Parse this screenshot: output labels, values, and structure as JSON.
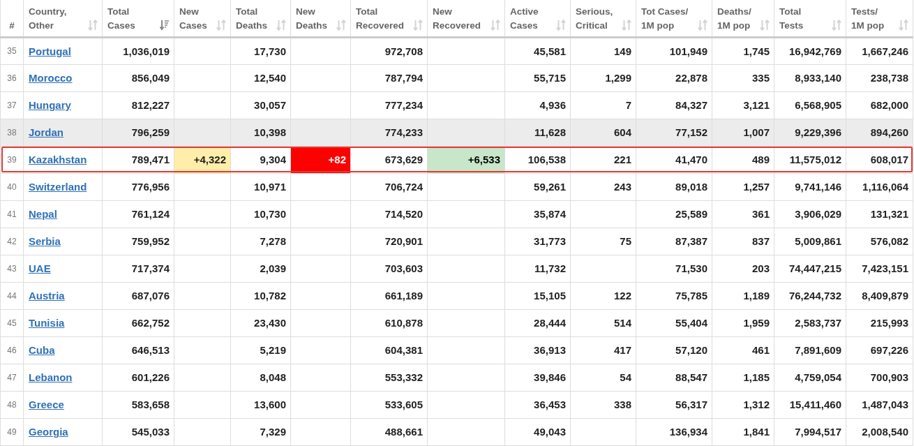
{
  "table": {
    "columns": [
      {
        "label": "#",
        "kind": "index"
      },
      {
        "label": "Country,\nOther",
        "kind": "country",
        "sorted": false
      },
      {
        "label": "Total\nCases",
        "kind": "number",
        "sorted": true
      },
      {
        "label": "New\nCases",
        "kind": "new-cases",
        "sorted": false
      },
      {
        "label": "Total\nDeaths",
        "kind": "number",
        "sorted": false
      },
      {
        "label": "New\nDeaths",
        "kind": "new-deaths",
        "sorted": false
      },
      {
        "label": "Total\nRecovered",
        "kind": "number",
        "sorted": false
      },
      {
        "label": "New\nRecovered",
        "kind": "new-recovered",
        "sorted": false
      },
      {
        "label": "Active\nCases",
        "kind": "number",
        "sorted": false
      },
      {
        "label": "Serious,\nCritical",
        "kind": "number",
        "sorted": false
      },
      {
        "label": "Tot Cases/\n1M pop",
        "kind": "number",
        "sorted": false
      },
      {
        "label": "Deaths/\n1M pop",
        "kind": "number",
        "sorted": false
      },
      {
        "label": "Total\nTests",
        "kind": "number",
        "sorted": false
      },
      {
        "label": "Tests/\n1M pop",
        "kind": "number",
        "sorted": false
      }
    ],
    "rows": [
      {
        "hovered": false,
        "highlighted": false,
        "cells": [
          "35",
          "Portugal",
          "1,036,019",
          null,
          "17,730",
          null,
          "972,708",
          null,
          "45,581",
          "149",
          "101,949",
          "1,745",
          "16,942,769",
          "1,667,246"
        ]
      },
      {
        "hovered": false,
        "highlighted": false,
        "cells": [
          "36",
          "Morocco",
          "856,049",
          null,
          "12,540",
          null,
          "787,794",
          null,
          "55,715",
          "1,299",
          "22,878",
          "335",
          "8,933,140",
          "238,738"
        ]
      },
      {
        "hovered": false,
        "highlighted": false,
        "cells": [
          "37",
          "Hungary",
          "812,227",
          null,
          "30,057",
          null,
          "777,234",
          null,
          "4,936",
          "7",
          "84,327",
          "3,121",
          "6,568,905",
          "682,000"
        ]
      },
      {
        "hovered": true,
        "highlighted": false,
        "cells": [
          "38",
          "Jordan",
          "796,259",
          null,
          "10,398",
          null,
          "774,233",
          null,
          "11,628",
          "604",
          "77,152",
          "1,007",
          "9,229,396",
          "894,260"
        ]
      },
      {
        "hovered": false,
        "highlighted": true,
        "cells": [
          "39",
          "Kazakhstan",
          "789,471",
          "+4,322",
          "9,304",
          "+82",
          "673,629",
          "+6,533",
          "106,538",
          "221",
          "41,470",
          "489",
          "11,575,012",
          "608,017"
        ]
      },
      {
        "hovered": false,
        "highlighted": false,
        "cells": [
          "40",
          "Switzerland",
          "776,956",
          null,
          "10,971",
          null,
          "706,724",
          null,
          "59,261",
          "243",
          "89,018",
          "1,257",
          "9,741,146",
          "1,116,064"
        ]
      },
      {
        "hovered": false,
        "highlighted": false,
        "cells": [
          "41",
          "Nepal",
          "761,124",
          null,
          "10,730",
          null,
          "714,520",
          null,
          "35,874",
          null,
          "25,589",
          "361",
          "3,906,029",
          "131,321"
        ]
      },
      {
        "hovered": false,
        "highlighted": false,
        "cells": [
          "42",
          "Serbia",
          "759,952",
          null,
          "7,278",
          null,
          "720,901",
          null,
          "31,773",
          "75",
          "87,387",
          "837",
          "5,009,861",
          "576,082"
        ]
      },
      {
        "hovered": false,
        "highlighted": false,
        "cells": [
          "43",
          "UAE",
          "717,374",
          null,
          "2,039",
          null,
          "703,603",
          null,
          "11,732",
          null,
          "71,530",
          "203",
          "74,447,215",
          "7,423,151"
        ]
      },
      {
        "hovered": false,
        "highlighted": false,
        "cells": [
          "44",
          "Austria",
          "687,076",
          null,
          "10,782",
          null,
          "661,189",
          null,
          "15,105",
          "122",
          "75,785",
          "1,189",
          "76,244,732",
          "8,409,879"
        ]
      },
      {
        "hovered": false,
        "highlighted": false,
        "cells": [
          "45",
          "Tunisia",
          "662,752",
          null,
          "23,430",
          null,
          "610,878",
          null,
          "28,444",
          "514",
          "55,404",
          "1,959",
          "2,583,737",
          "215,993"
        ]
      },
      {
        "hovered": false,
        "highlighted": false,
        "cells": [
          "46",
          "Cuba",
          "646,513",
          null,
          "5,219",
          null,
          "604,381",
          null,
          "36,913",
          "417",
          "57,120",
          "461",
          "7,891,609",
          "697,226"
        ]
      },
      {
        "hovered": false,
        "highlighted": false,
        "cells": [
          "47",
          "Lebanon",
          "601,226",
          null,
          "8,048",
          null,
          "553,332",
          null,
          "39,846",
          "54",
          "88,547",
          "1,185",
          "4,759,054",
          "700,903"
        ]
      },
      {
        "hovered": false,
        "highlighted": false,
        "cells": [
          "48",
          "Greece",
          "583,658",
          null,
          "13,600",
          null,
          "533,605",
          null,
          "36,453",
          "338",
          "56,317",
          "1,312",
          "15,411,460",
          "1,487,043"
        ]
      },
      {
        "hovered": false,
        "highlighted": false,
        "cells": [
          "49",
          "Georgia",
          "545,033",
          null,
          "7,329",
          null,
          "488,661",
          null,
          "49,043",
          null,
          "136,934",
          "1,841",
          "7,994,517",
          "2,008,540"
        ]
      }
    ]
  }
}
